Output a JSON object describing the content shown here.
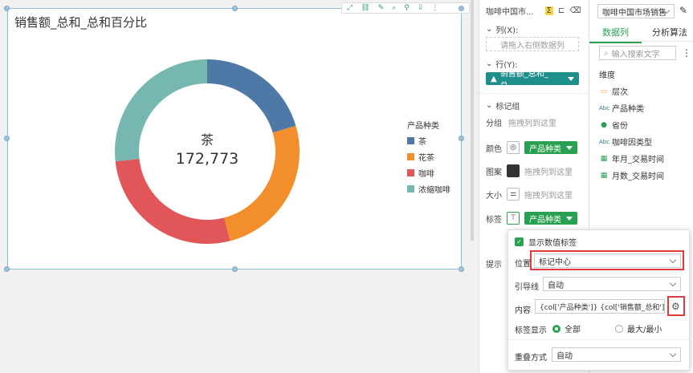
{
  "chart": {
    "title": "销售额_总和_总和百分比",
    "center_label": "茶",
    "center_value": "172,773",
    "legend_title": "产品种类"
  },
  "chart_data": {
    "type": "pie",
    "title": "销售额_总和_总和百分比",
    "categories": [
      "茶",
      "花茶",
      "咖啡",
      "浓缩咖啡"
    ],
    "values": [
      20.5,
      25.5,
      27.3,
      26.7
    ],
    "colors": [
      "#4e79a7",
      "#f28e2b",
      "#e15759",
      "#76b7b2"
    ],
    "donut": true,
    "legend_position": "right"
  },
  "mid_panel": {
    "dataset_name": "咖啡中国市...",
    "columns_label": "列(X):",
    "columns_placeholder": "请拖入右侧数据列",
    "rows_label": "行(Y):",
    "rows_pill": "销售额_总和_总...",
    "marks_label": "标记组",
    "group_label": "分组",
    "group_placeholder": "拖拽列到这里",
    "color_label": "颜色",
    "color_pill": "产品种类",
    "shape_label": "图案",
    "shape_placeholder": "拖拽列到这里",
    "size_label": "大小",
    "size_placeholder": "拖拽列到这里",
    "tag_label": "标签",
    "tag_pill": "产品种类",
    "tooltip_label": "提示"
  },
  "right_panel": {
    "dataset_select": "咖啡中国市场销售",
    "tab_data": "数据列",
    "tab_analysis": "分析算法",
    "search_placeholder": "输入搜索文字",
    "dimension_label": "维度",
    "fields": [
      {
        "icon": "folder-icon",
        "label": "层次"
      },
      {
        "icon": "text-field-icon",
        "label": "产品种类"
      },
      {
        "icon": "globe-icon",
        "label": "省份"
      },
      {
        "icon": "text-field-icon",
        "label": "咖啡因类型"
      },
      {
        "icon": "calendar-icon",
        "label": "年月_交易时间"
      },
      {
        "icon": "calendar-icon",
        "label": "月数_交易时间"
      }
    ]
  },
  "popup": {
    "show_value_label": "显示数值标签",
    "position_label": "位置",
    "position_value": "标记中心",
    "leader_label": "引导线",
    "leader_value": "自动",
    "content_label": "内容",
    "content_value": "{col['产品种类']} {col['销售额_总和']}",
    "display_label": "标签显示",
    "display_all": "全部",
    "display_maxmin": "最大/最小",
    "overlap_label": "重叠方式",
    "overlap_value": "自动"
  },
  "colors": {
    "accent": "#2aa152",
    "teal": "#1f8f8b",
    "highlight": "#e23b3b"
  }
}
